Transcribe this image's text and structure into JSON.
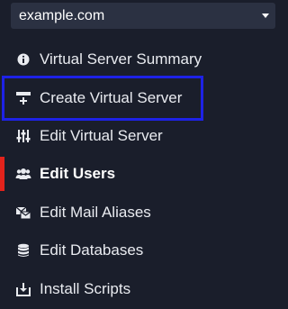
{
  "domain_select": {
    "value": "example.com"
  },
  "menu": {
    "items": [
      {
        "label": "Virtual Server Summary",
        "icon": "info-circle-icon"
      },
      {
        "label": "Create Virtual Server",
        "icon": "add-server-icon"
      },
      {
        "label": "Edit Virtual Server",
        "icon": "sliders-icon"
      },
      {
        "label": "Edit Users",
        "icon": "users-icon",
        "active": true
      },
      {
        "label": "Edit Mail Aliases",
        "icon": "mail-aliases-icon"
      },
      {
        "label": "Edit Databases",
        "icon": "database-icon"
      },
      {
        "label": "Install Scripts",
        "icon": "install-icon"
      }
    ]
  },
  "colors": {
    "background": "#1a1e2b",
    "select_background": "#2b3142",
    "active_indicator": "#e3231c",
    "highlight_border": "#1e22e6",
    "text": "#e9ebf0"
  }
}
